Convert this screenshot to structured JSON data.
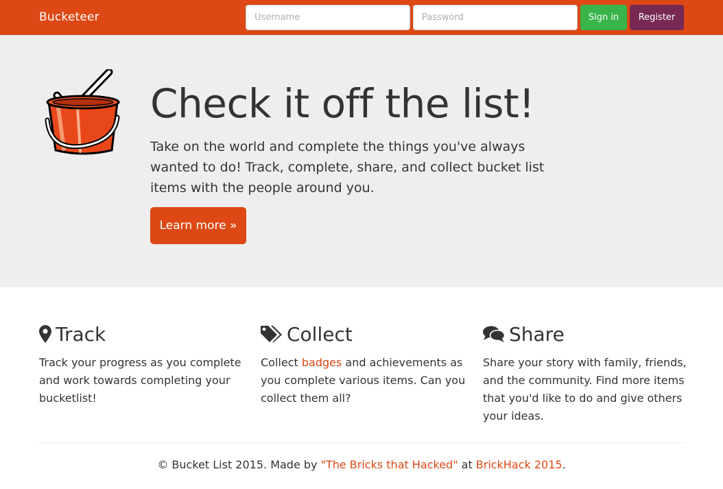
{
  "navbar": {
    "brand": "Bucketeer",
    "username_placeholder": "Username",
    "password_placeholder": "Password",
    "signin_label": "Sign in",
    "register_label": "Register"
  },
  "hero": {
    "logo_icon": "bucket-check-icon",
    "title": "Check it off the list!",
    "text": "Take on the world and complete the things you've always wanted to do! Track, complete, share, and collect bucket list items with the people around you.",
    "button_label": "Learn more »"
  },
  "features": [
    {
      "icon": "map-marker-icon",
      "title": "Track",
      "text": "Track your progress as you complete and work towards completing your bucketlist!"
    },
    {
      "icon": "tags-icon",
      "title": "Collect",
      "text_before": "Collect ",
      "link": "badges",
      "text_after": " and achievements as you complete various items. Can you collect them all?"
    },
    {
      "icon": "comments-icon",
      "title": "Share",
      "text": "Share your story with family, friends, and the community. Find more items that you'd like to do and give others your ideas."
    }
  ],
  "footer": {
    "prefix": "© Bucket List 2015. Made by ",
    "team_link": "\"The Bricks that Hacked\"",
    "middle": " at ",
    "event_link": "BrickHack 2015",
    "suffix": "."
  },
  "colors": {
    "brand": "#dd4814",
    "signin": "#38b44a",
    "register": "#772953",
    "jumbotron": "#eeeeee"
  }
}
